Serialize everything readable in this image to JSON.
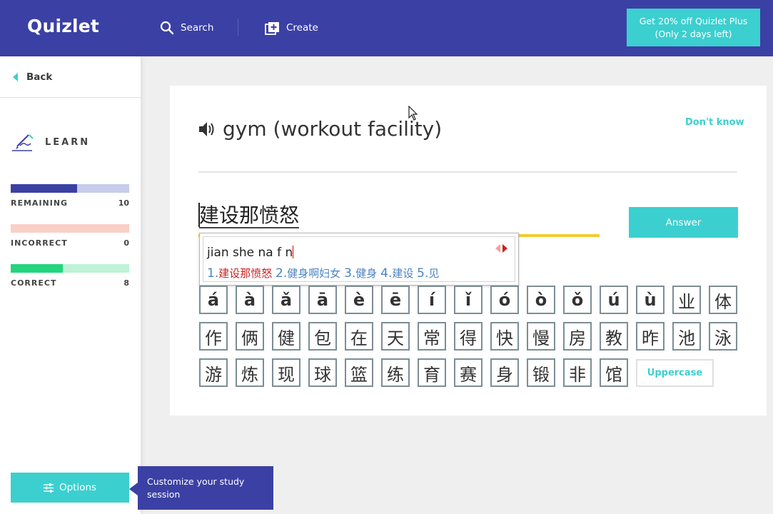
{
  "header": {
    "logo": "Quizlet",
    "search_label": "Search",
    "create_label": "Create",
    "promo_line1": "Get 20% off Quizlet Plus",
    "promo_line2": "(Only 2 days left)"
  },
  "sidebar": {
    "back_label": "Back",
    "mode_label": "LEARN",
    "progress": [
      {
        "label": "REMAINING",
        "value": "10",
        "fraction": 0.56,
        "color": "#3b40a4",
        "track": "#c6ccea"
      },
      {
        "label": "INCORRECT",
        "value": "0",
        "fraction": 0,
        "color": "#ff725b",
        "track": "#f9cfc7"
      },
      {
        "label": "CORRECT",
        "value": "8",
        "fraction": 0.44,
        "color": "#23d57c",
        "track": "#bff2d6"
      }
    ],
    "options_label": "Options",
    "tooltip_text": "Customize your study session"
  },
  "card": {
    "term": "gym (workout facility)",
    "dont_know": "Don't know",
    "answer_text": "建设那愤怒",
    "answer_button": "Answer",
    "uppercase_button": "Uppercase"
  },
  "ime": {
    "input": "jian she na f n",
    "candidates": [
      {
        "num": "1.",
        "text": "建设那愤怒"
      },
      {
        "num": "2.",
        "text": "健身啊妇女"
      },
      {
        "num": "3.",
        "text": "健身"
      },
      {
        "num": "4.",
        "text": "建设"
      },
      {
        "num": "5.",
        "text": "见"
      }
    ]
  },
  "keys": {
    "row1": [
      "á",
      "à",
      "ǎ",
      "ā",
      "è",
      "ē",
      "í",
      "ǐ",
      "ó",
      "ò",
      "ǒ",
      "ú",
      "ù",
      "业",
      "体"
    ],
    "row2": [
      "作",
      "俩",
      "健",
      "包",
      "在",
      "天",
      "常",
      "得",
      "快",
      "慢",
      "房",
      "教",
      "昨",
      "池",
      "泳"
    ],
    "row3": [
      "游",
      "炼",
      "现",
      "球",
      "篮",
      "练",
      "育",
      "赛",
      "身",
      "锻",
      "非",
      "馆"
    ]
  },
  "colors": {
    "brand": "#3b40a4",
    "accent": "#3ccfcf",
    "answer_underline": "#f0cd2c"
  }
}
